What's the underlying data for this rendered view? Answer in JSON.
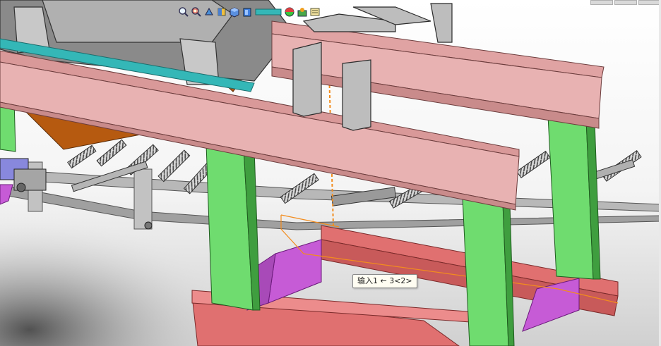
{
  "window": {
    "title": "",
    "controls": [
      "minimize",
      "maximize",
      "close"
    ]
  },
  "heads_up_toolbar": {
    "items": [
      {
        "name": "zoom-to-fit-icon"
      },
      {
        "name": "zoom-to-area-icon"
      },
      {
        "name": "previous-view-icon"
      },
      {
        "name": "section-view-icon"
      },
      {
        "name": "view-orientation-icon"
      },
      {
        "name": "display-style-icon"
      },
      {
        "name": "hide-show-items-icon"
      },
      {
        "name": "edit-appearance-icon"
      },
      {
        "name": "apply-scene-icon"
      },
      {
        "name": "view-settings-icon"
      }
    ]
  },
  "callout": {
    "text": "输入1 ← 3<2>"
  },
  "colors": {
    "beam": "#e0a3a3",
    "beam_dark": "#c98b8b",
    "column": "#6fdc6f",
    "column_dark": "#3f9e3f",
    "base_frame": "#e07070",
    "brace": "#d36fe0",
    "conveyor": "#a8a8a8",
    "hopper": "#b65a10",
    "sketch_line": "#f28c1e",
    "teal_strip": "#34b7b7"
  }
}
